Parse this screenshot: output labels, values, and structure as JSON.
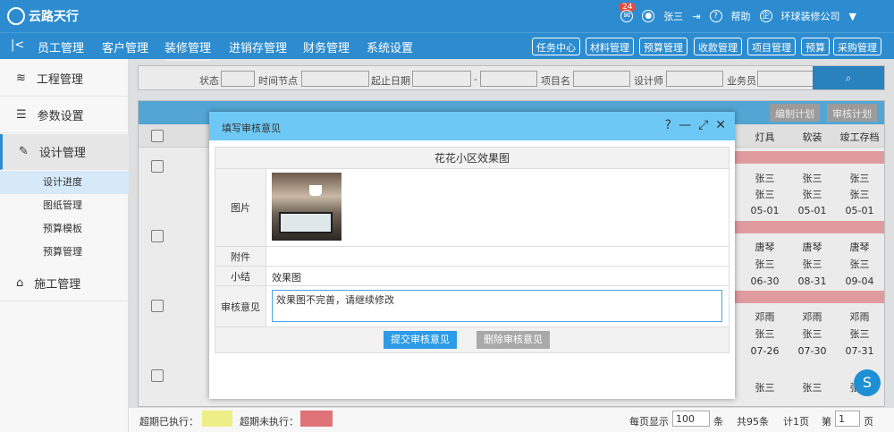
{
  "app": {
    "logo_text": "云路天行",
    "notify_count": "24",
    "user": "张三",
    "help": "帮助",
    "company": "环球装修公司"
  },
  "nav": {
    "items": [
      "员工管理",
      "客户管理",
      "装修管理",
      "进销存管理",
      "财务管理",
      "系统设置"
    ],
    "quick": [
      "任务中心",
      "材料管理",
      "预算管理",
      "收款管理",
      "项目管理",
      "预算",
      "采购管理"
    ]
  },
  "sidebar": {
    "items": [
      "工程管理",
      "参数设置",
      "设计管理",
      "施工管理"
    ],
    "sub": [
      "设计进度",
      "图纸管理",
      "预算模板",
      "预算管理"
    ]
  },
  "filter": {
    "labels": [
      "状态",
      "时间节点",
      "起止日期",
      "-",
      "项目名",
      "设计师",
      "业务员"
    ]
  },
  "grid": {
    "buttons": [
      "编制计划",
      "审核计划"
    ],
    "headers": [
      "灯具",
      "软装",
      "竣工存档"
    ],
    "cells": [
      [
        "张三",
        "张三",
        "张三"
      ],
      [
        "张三",
        "张三",
        "张三"
      ],
      [
        "05-01",
        "05-01",
        "05-01"
      ],
      [
        "唐琴",
        "唐琴",
        "唐琴"
      ],
      [
        "张三",
        "张三",
        "张三"
      ],
      [
        "06-30",
        "08-31",
        "09-04"
      ],
      [
        "邓雨",
        "邓雨",
        "邓雨"
      ],
      [
        "张三",
        "张三",
        "张三"
      ],
      [
        "07-26",
        "07-30",
        "07-31"
      ],
      [
        "张三",
        "张三",
        "张三"
      ]
    ]
  },
  "footer": {
    "overdue_done": "超期已执行：",
    "overdue_undone": "超期未执行：",
    "per_page_label": "每页显示",
    "per_page": "100",
    "unit": "条",
    "total": "共95条",
    "pages": "计1页",
    "page_prefix": "第",
    "page": "1",
    "page_suffix": "页"
  },
  "dialog": {
    "title": "填写审核意见",
    "project": "花花小区效果图",
    "label_image": "图片",
    "label_attach": "附件",
    "label_summary": "小结",
    "summary": "效果图",
    "label_opinion": "审核意见",
    "opinion": "效果图不完善，请继续修改",
    "submit": "提交审核意见",
    "delete": "删除审核意见"
  }
}
